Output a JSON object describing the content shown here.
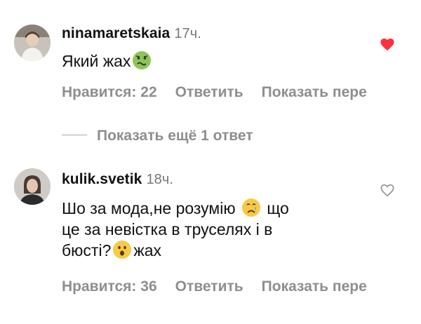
{
  "comments": [
    {
      "username": "ninamaretskaia",
      "time": "17ч.",
      "text": [
        "Який жах"
      ],
      "emoji": "nauseated-face-emoji",
      "liked": true,
      "likes_label": "Нравится: 22",
      "reply_label": "Ответить",
      "translate_label": "Показать пере"
    },
    {
      "username": "kulik.svetik",
      "time": "18ч.",
      "text_line1_a": "Шо за мода,не розумію",
      "text_line1_b": "що",
      "text_line2": "це за невістка в труселях і в",
      "text_line3_a": "бюсті?",
      "text_line3_b": "жах",
      "emoji_1": "crying-face-emoji",
      "emoji_2": "astonished-face-emoji",
      "liked": false,
      "likes_label": "Нравится: 36",
      "reply_label": "Ответить",
      "translate_label": "Показать пере"
    }
  ],
  "more_replies_label": "Показать ещё 1 ответ",
  "colors": {
    "heart_liked": "#ff3040",
    "secondary": "#8e8e8e"
  }
}
